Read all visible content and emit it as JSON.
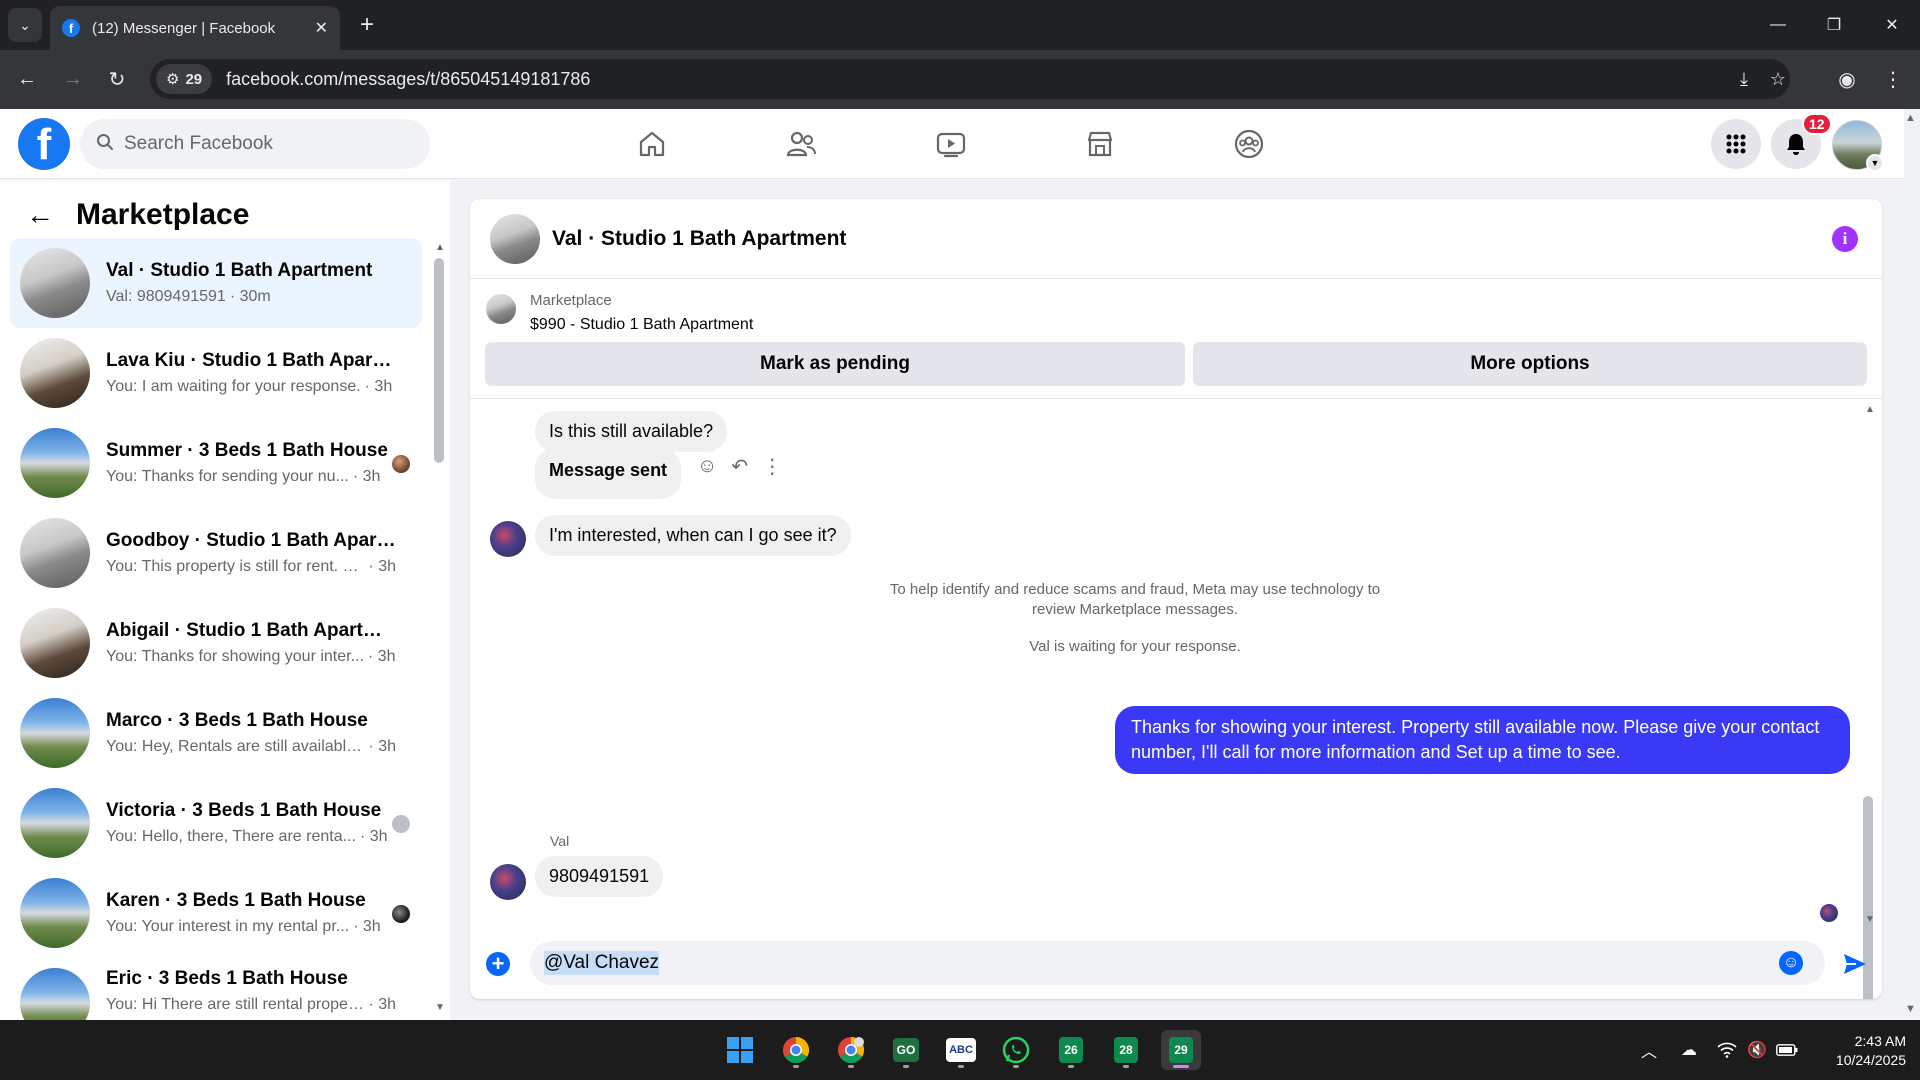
{
  "browser": {
    "tab_title": "(12) Messenger | Facebook",
    "url": "facebook.com/messages/t/865045149181786",
    "site_chip_count": "29"
  },
  "fb": {
    "search_placeholder": "Search Facebook",
    "notification_count": "12",
    "brand_color": "#1877f2"
  },
  "sidebar": {
    "title": "Marketplace",
    "conversations": [
      {
        "name": "Val · Studio 1 Bath Apartment",
        "snippet": "Val: 9809491591",
        "time": "· 30m"
      },
      {
        "name": "Lava Kiu · Studio 1 Bath Apartm...",
        "snippet": "You: I am waiting for your response.",
        "time": "· 3h"
      },
      {
        "name": "Summer · 3 Beds 1 Bath House",
        "snippet": "You: Thanks for sending your nu...",
        "time": "· 3h"
      },
      {
        "name": "Goodboy · Studio 1 Bath Apartm...",
        "snippet": "You: This property is still for rent. Ki...",
        "time": "· 3h"
      },
      {
        "name": "Abigail · Studio 1 Bath Apartment",
        "snippet": "You: Thanks for showing your inter...",
        "time": "· 3h"
      },
      {
        "name": "Marco · 3 Beds 1 Bath House",
        "snippet": "You: Hey, Rentals are still available. ...",
        "time": "· 3h"
      },
      {
        "name": "Victoria · 3 Beds 1 Bath House",
        "snippet": "You: Hello, there, There are renta...",
        "time": "· 3h"
      },
      {
        "name": "Karen · 3 Beds 1 Bath House",
        "snippet": "You: Your interest in my rental pr...",
        "time": "· 3h"
      },
      {
        "name": "Eric · 3 Beds 1 Bath House",
        "snippet": "You: Hi There are still rental propert...",
        "time": "· 3h"
      }
    ]
  },
  "chat": {
    "title": "Val · Studio 1 Bath Apartment",
    "listing_category": "Marketplace",
    "listing_price_title": "$990 - Studio 1 Bath Apartment",
    "mark_pending_label": "Mark as pending",
    "more_options_label": "More options",
    "messages": {
      "m1": "Is this still available?",
      "m2": "Message sent",
      "m3": "I'm interested, when can I go see it?",
      "notice": "To help identify and reduce scams and fraud, Meta may use technology to review Marketplace messages.",
      "waiting": "Val is waiting for your response.",
      "outgoing": "Thanks for showing your interest. Property still available now. Please give your contact number, I'll call for more information and Set up a time to see.",
      "sender": "Val",
      "m4": "9809491591"
    },
    "composer_value": "@Val Chavez",
    "accent_color": "#3a3af6"
  },
  "taskbar": {
    "apps": [
      {
        "icon": "windows-start-icon",
        "label": ""
      },
      {
        "icon": "chrome-icon",
        "label": ""
      },
      {
        "icon": "chrome-profile-icon",
        "label": ""
      },
      {
        "icon": "go-app-icon",
        "label": "GO"
      },
      {
        "icon": "abc-proxy-icon",
        "label": "ABC"
      },
      {
        "icon": "whatsapp-icon",
        "label": ""
      },
      {
        "icon": "app-26-icon",
        "label": "26"
      },
      {
        "icon": "app-28-icon",
        "label": "28"
      },
      {
        "icon": "app-29-icon",
        "label": "29"
      }
    ],
    "time": "2:43 AM",
    "date": "10/24/2025"
  }
}
